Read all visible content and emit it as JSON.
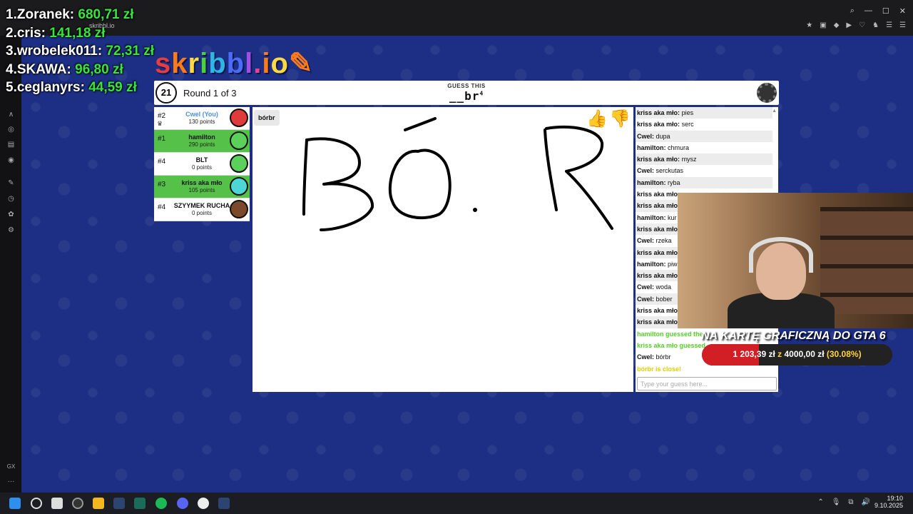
{
  "browser": {
    "tab_text": "skribbl.io",
    "window_controls": [
      "⌕",
      "—",
      "☐",
      "✕"
    ],
    "extensions": [
      "★",
      "▣",
      "◆",
      "▶",
      "♡",
      "♞",
      "☰",
      "☰"
    ]
  },
  "leaderboard": [
    {
      "rank": "1.",
      "name": "Zoranek:",
      "amount": "680,71 zł"
    },
    {
      "rank": "2.",
      "name": "cris:",
      "amount": "141,18 zł"
    },
    {
      "rank": "3.",
      "name": "wrobelek011:",
      "amount": "72,31 zł"
    },
    {
      "rank": "4.",
      "name": "SKAWA:",
      "amount": "96,80 zł"
    },
    {
      "rank": "5.",
      "name": "ceglanyrs:",
      "amount": "44,59 zł"
    }
  ],
  "logo": {
    "text": "skribbl.io",
    "colors": [
      "#e53e3e",
      "#ff7b1a",
      "#ffd93d",
      "#4cd137",
      "#2fb5e3",
      "#4a6cf7",
      "#a04ee3",
      "#e84393",
      "#ff7b1a",
      "#ffd93d"
    ]
  },
  "header": {
    "timer": "21",
    "round": "Round 1 of 3",
    "guess_label": "GUESS THIS",
    "word_hint": "__br",
    "word_hint_count": "4"
  },
  "players": [
    {
      "rank": "#2",
      "name": "Cwel (You)",
      "points": "130 points",
      "you": true,
      "guessed": false,
      "avatar_color": "#e03b3b",
      "crown": "♛"
    },
    {
      "rank": "#1",
      "name": "hamilton",
      "points": "290 points",
      "you": false,
      "guessed": true,
      "avatar_color": "#5bd05b"
    },
    {
      "rank": "#4",
      "name": "BLT",
      "points": "0 points",
      "you": false,
      "guessed": false,
      "avatar_color": "#5bd05b"
    },
    {
      "rank": "#3",
      "name": "kriss aka mło",
      "points": "105 points",
      "you": false,
      "guessed": true,
      "avatar_color": "#4ed6d6"
    },
    {
      "rank": "#4",
      "name": "SZYYMEK RUCHA",
      "points": "0 points",
      "you": false,
      "guessed": false,
      "avatar_color": "#7a4a2a"
    }
  ],
  "canvas": {
    "drawer_bubble": "bórbr",
    "thumb_up": "👍",
    "thumb_down": "👎"
  },
  "chat": {
    "messages": [
      {
        "user": "kriss aka mło:",
        "text": "pies"
      },
      {
        "user": "kriss aka mło:",
        "text": "serc"
      },
      {
        "user": "Cwel:",
        "text": "dupa"
      },
      {
        "user": "hamilton:",
        "text": "chmura"
      },
      {
        "user": "kriss aka mło:",
        "text": "mysz"
      },
      {
        "user": "Cwel:",
        "text": "serckutas"
      },
      {
        "user": "hamilton:",
        "text": "ryba"
      },
      {
        "user": "kriss aka mło:",
        "text": ""
      },
      {
        "user": "kriss aka mło:",
        "text": ""
      },
      {
        "user": "hamilton:",
        "text": "kur"
      },
      {
        "user": "kriss aka mło:",
        "text": ""
      },
      {
        "user": "Cwel:",
        "text": "rzeka"
      },
      {
        "user": "kriss aka mło:",
        "text": ""
      },
      {
        "user": "hamilton:",
        "text": "piw"
      },
      {
        "user": "kriss aka mło:",
        "text": ""
      },
      {
        "user": "Cwel:",
        "text": "woda"
      },
      {
        "user": "Cwel:",
        "text": "bober"
      },
      {
        "user": "kriss aka mło:",
        "text": ""
      },
      {
        "user": "kriss aka mło:",
        "text": ""
      }
    ],
    "correct": [
      "hamilton guessed the",
      "kriss aka mło guessed"
    ],
    "last_message": {
      "user": "Cwel:",
      "text": "bórbr"
    },
    "close_notice": "bórbr is close!",
    "input_placeholder": "Type your guess here..."
  },
  "donation_goal": {
    "title": "NA KARTĘ GRAFICZNĄ DO GTA 6",
    "current": "1 203,39 zł",
    "separator": "z",
    "target": "4000,00 zł",
    "percent": "(30.08%)",
    "fraction": 0.3008
  },
  "taskbar": {
    "time": "19:10",
    "date": "9.10.2025",
    "tray": [
      "⌃",
      "🎙",
      "⧉",
      "🔊"
    ]
  },
  "rail": [
    "∧",
    "◎",
    "▤",
    "◉",
    "✎",
    "◷",
    "✿",
    "⚙"
  ],
  "rail_bottom": [
    "GX",
    "···"
  ]
}
